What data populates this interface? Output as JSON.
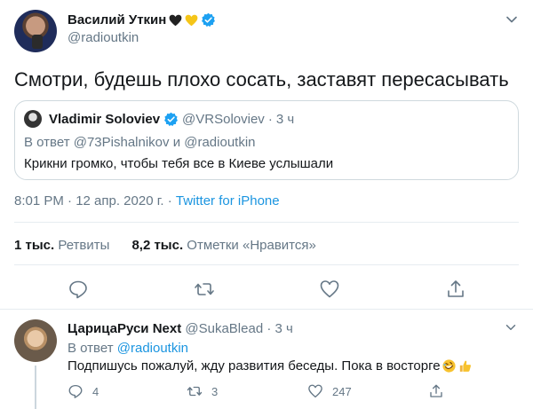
{
  "tweet": {
    "author_name": "Василий Уткин",
    "handle": "@radioutkin",
    "text": "Смотри, будешь плохо сосать, заставят пересасывать",
    "quote": {
      "name": "Vladimir Soloviev",
      "handle": "@VRSoloviev",
      "dot": "·",
      "time": "3 ч",
      "reply_to": "В ответ @73Pishalnikov и @radioutkin",
      "text": "Крикни громко, чтобы тебя все в Киеве услышали"
    },
    "meta_time": "8:01 PM · 12 апр. 2020 г. · ",
    "meta_source": "Twitter for iPhone",
    "retweets_count": "1 тыс.",
    "retweets_label": "Ретвиты",
    "likes_count": "8,2 тыс.",
    "likes_label": "Отметки «Нравится»",
    "icons": [
      "reply-icon",
      "retweet-icon",
      "like-icon",
      "share-icon"
    ],
    "colors": {
      "accent": "#1da1f2",
      "link": "#1b95e0",
      "secondary_text": "#657786"
    }
  },
  "reply": {
    "name": "ЦарицаРуси Next",
    "handle": "@SukaBlead",
    "dot": "·",
    "time": "3 ч",
    "reply_prefix": "В ответ ",
    "reply_link": "@radioutkin",
    "text": "Подпишусь пожалуй, жду развития беседы. Пока в восторге",
    "reply_count": "4",
    "retweet_count": "3",
    "like_count": "247"
  }
}
